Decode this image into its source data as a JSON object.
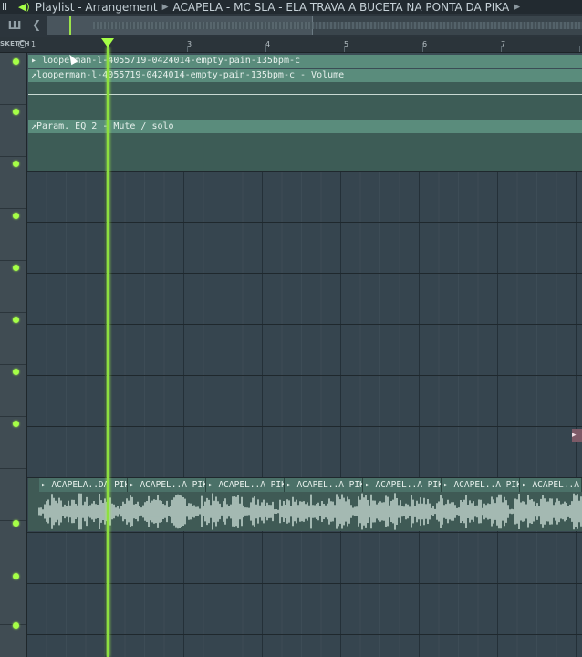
{
  "titlebar": {
    "left_glyph": "ll",
    "window": "Playlist",
    "view": "Arrangement",
    "project": "ACAPELA - MC SLA - ELA TRAVA A BUCETA NA PONTA DA PIKA"
  },
  "ruler": {
    "sketch_label": "SKETCH",
    "bars": [
      "1",
      "3",
      "4",
      "5",
      "6",
      "7"
    ]
  },
  "tracks": {
    "clip1_name": "looperman-l-4055719-0424014-empty-pain-135bpm-c",
    "clip2_name": "looperman-l-4055719-0424014-empty-pain-135bpm-c - Volume",
    "clip3_name": "Param. EQ 2 - Mute / solo",
    "audio_segments": [
      "ACAPELA..DA PIKA",
      "ACAPEL..A PIKA",
      "ACAPEL..A PIKA",
      "ACAPEL..A PIKA",
      "ACAPEL..A PIKA",
      "ACAPEL..A PIKA",
      "ACAPEL..A PIKA",
      "ACAPE"
    ]
  },
  "colors": {
    "accent": "#a6ff47",
    "grid_bg": "#36454f",
    "clip_green": "#5a8c7c",
    "audio_clip": "#4b7168"
  }
}
